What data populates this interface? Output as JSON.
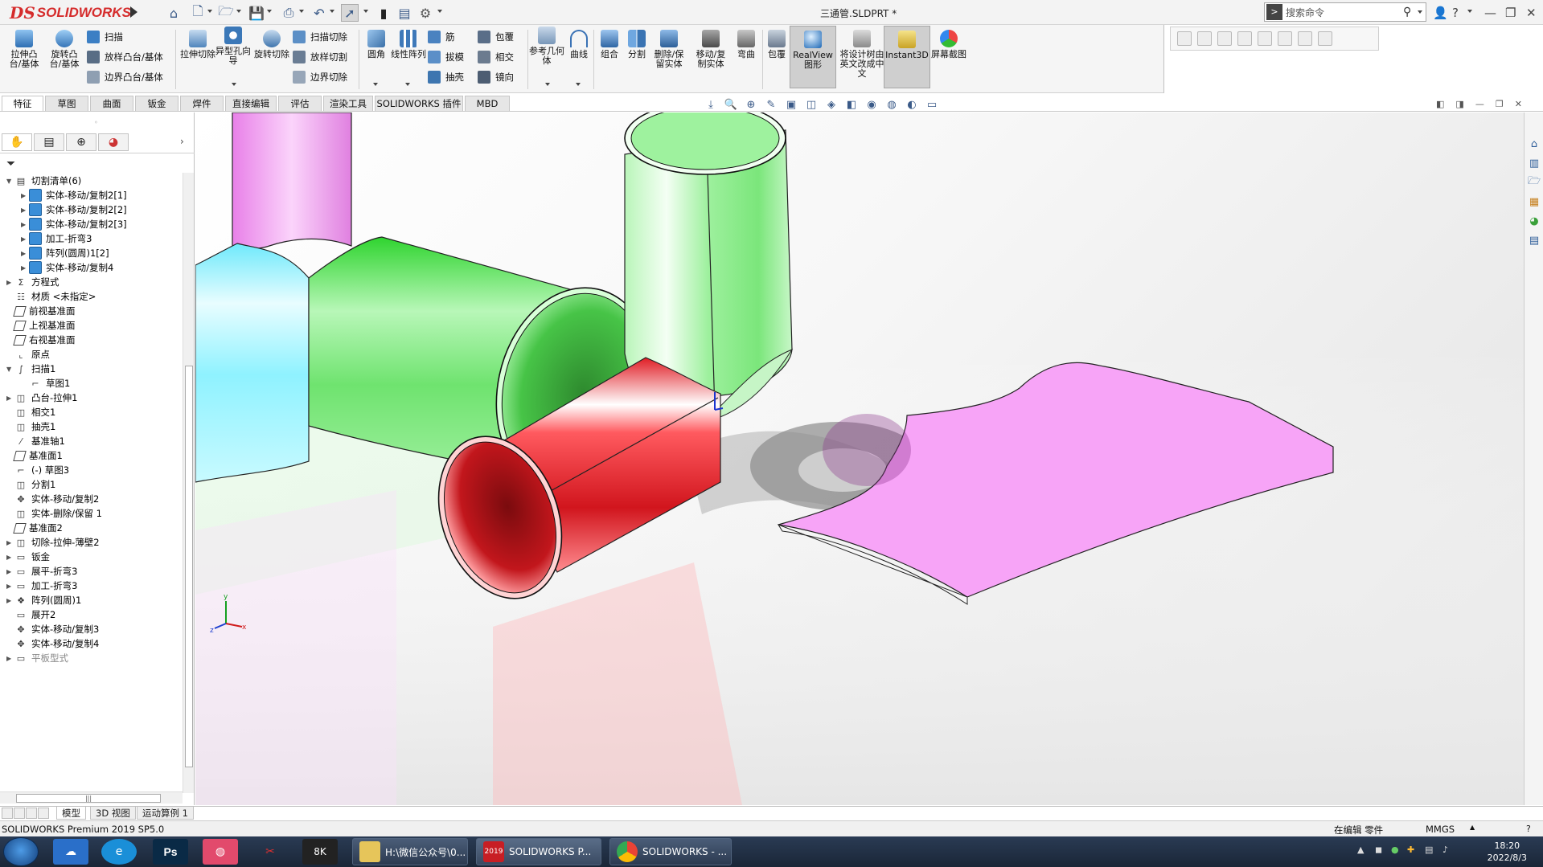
{
  "app": {
    "logo_ds": "DS",
    "logo_name": "SOLIDWORKS",
    "doc_title": "三通管.SLDPRT *",
    "search_placeholder": "搜索命令"
  },
  "commands": {
    "extrude_boss": "拉伸凸台/基体",
    "revolve_boss": "旋转凸台/基体",
    "sweep": "扫描",
    "loft_boss": "放样凸台/基体",
    "boundary_boss": "边界凸台/基体",
    "extrude_cut": "拉伸切除",
    "hole_wizard": "异型孔向导",
    "revolve_cut": "旋转切除",
    "swept_cut": "扫描切除",
    "lofted_cut": "放样切割",
    "boundary_cut": "边界切除",
    "fillet": "圆角",
    "linear_pattern": "线性阵列",
    "rib": "筋",
    "draft": "拔模",
    "shell": "抽壳",
    "wrap": "包覆",
    "intersect": "相交",
    "mirror": "镜向",
    "ref_geometry": "参考几何体",
    "curves": "曲线",
    "combine": "组合",
    "split": "分割",
    "delete_keep_body": "删除/保留实体",
    "move_copy_body": "移动/复制实体",
    "flex": "弯曲",
    "wrap2": "包覆",
    "realview": "RealView图形",
    "translate": "将设计树由英文改成中文",
    "instant3d": "Instant3D",
    "screenshot": "屏幕截图"
  },
  "tabs": [
    "特征",
    "草图",
    "曲面",
    "钣金",
    "焊件",
    "直接编辑",
    "评估",
    "渲染工具",
    "SOLIDWORKS 插件",
    "MBD"
  ],
  "tree": [
    {
      "label": "切割清单(6)",
      "indent": 0,
      "arrow": "▼",
      "icon": "cutlist"
    },
    {
      "label": "实体-移动/复制2[1]",
      "indent": 1,
      "arrow": "▶",
      "icon": "box"
    },
    {
      "label": "实体-移动/复制2[2]",
      "indent": 1,
      "arrow": "▶",
      "icon": "box"
    },
    {
      "label": "实体-移动/复制2[3]",
      "indent": 1,
      "arrow": "▶",
      "icon": "box"
    },
    {
      "label": "加工-折弯3",
      "indent": 1,
      "arrow": "▶",
      "icon": "box"
    },
    {
      "label": "阵列(圆周)1[2]",
      "indent": 1,
      "arrow": "▶",
      "icon": "box"
    },
    {
      "label": "实体-移动/复制4",
      "indent": 1,
      "arrow": "▶",
      "icon": "box"
    },
    {
      "label": "方程式",
      "indent": 0,
      "arrow": "▶",
      "icon": "sigma"
    },
    {
      "label": "材质 <未指定>",
      "indent": 0,
      "arrow": "",
      "icon": "material"
    },
    {
      "label": "前视基准面",
      "indent": 0,
      "arrow": "",
      "icon": "plane"
    },
    {
      "label": "上视基准面",
      "indent": 0,
      "arrow": "",
      "icon": "plane"
    },
    {
      "label": "右视基准面",
      "indent": 0,
      "arrow": "",
      "icon": "plane"
    },
    {
      "label": "原点",
      "indent": 0,
      "arrow": "",
      "icon": "origin"
    },
    {
      "label": "扫描1",
      "indent": 0,
      "arrow": "▼",
      "icon": "sweep"
    },
    {
      "label": "草图1",
      "indent": 1,
      "arrow": "",
      "icon": "sketch"
    },
    {
      "label": "凸台-拉伸1",
      "indent": 0,
      "arrow": "▶",
      "icon": "feat"
    },
    {
      "label": "相交1",
      "indent": 0,
      "arrow": "",
      "icon": "feat"
    },
    {
      "label": "抽壳1",
      "indent": 0,
      "arrow": "",
      "icon": "feat"
    },
    {
      "label": "基准轴1",
      "indent": 0,
      "arrow": "",
      "icon": "axis"
    },
    {
      "label": "基准面1",
      "indent": 0,
      "arrow": "",
      "icon": "plane"
    },
    {
      "label": "(-) 草图3",
      "indent": 0,
      "arrow": "",
      "icon": "sketch"
    },
    {
      "label": "分割1",
      "indent": 0,
      "arrow": "",
      "icon": "feat"
    },
    {
      "label": "实体-移动/复制2",
      "indent": 0,
      "arrow": "",
      "icon": "move"
    },
    {
      "label": "实体-删除/保留 1",
      "indent": 0,
      "arrow": "",
      "icon": "feat"
    },
    {
      "label": "基准面2",
      "indent": 0,
      "arrow": "",
      "icon": "plane"
    },
    {
      "label": "切除-拉伸-薄壁2",
      "indent": 0,
      "arrow": "▶",
      "icon": "feat"
    },
    {
      "label": "钣金",
      "indent": 0,
      "arrow": "▶",
      "icon": "sheet"
    },
    {
      "label": "展平-折弯3",
      "indent": 0,
      "arrow": "▶",
      "icon": "sheet"
    },
    {
      "label": "加工-折弯3",
      "indent": 0,
      "arrow": "▶",
      "icon": "sheet"
    },
    {
      "label": "阵列(圆周)1",
      "indent": 0,
      "arrow": "▶",
      "icon": "pattern"
    },
    {
      "label": "展开2",
      "indent": 0,
      "arrow": "",
      "icon": "sheet"
    },
    {
      "label": "实体-移动/复制3",
      "indent": 0,
      "arrow": "",
      "icon": "move"
    },
    {
      "label": "实体-移动/复制4",
      "indent": 0,
      "arrow": "",
      "icon": "move"
    },
    {
      "label": "平板型式",
      "indent": 0,
      "arrow": "▶",
      "icon": "flat",
      "dim": true
    }
  ],
  "bottom_tabs": [
    "模型",
    "3D 视图",
    "运动算例 1"
  ],
  "status": {
    "product": "SOLIDWORKS Premium 2019 SP5.0",
    "editing": "在编辑 零件",
    "units": "MMGS"
  },
  "triad": {
    "x": "x",
    "y": "y",
    "z": "z"
  },
  "taskbar": {
    "win1": "H:\\微信公众号\\0...",
    "win2": "SOLIDWORKS P...",
    "win3": "SOLIDWORKS - ...",
    "sw_badge": "2019",
    "time": "18:20",
    "date": "2022/8/3"
  },
  "colors": {
    "brand": "#d52b2b",
    "green_pipe": "#5ee05e",
    "red_pipe": "#e8232a",
    "cyan_pipe": "#7af2ff",
    "pink_pipe": "#f2a0f2"
  }
}
